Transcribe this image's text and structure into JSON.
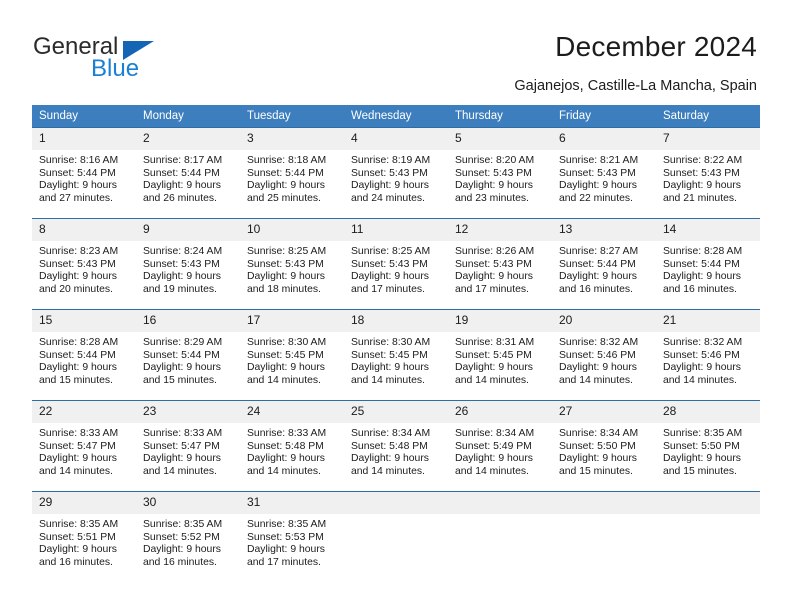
{
  "brand": {
    "name_top": "General",
    "name_bottom": "Blue",
    "triangle_color": "#1565b5",
    "blue_color": "#1b7fd4"
  },
  "header": {
    "title": "December 2024",
    "subtitle": "Gajanejos, Castille-La Mancha, Spain"
  },
  "theme": {
    "header_row_bg": "#3d7ebe",
    "cell_top_border": "#2e6da4",
    "daynum_bg": "#f0f0f0"
  },
  "calendar": {
    "weekday_headers": [
      "Sunday",
      "Monday",
      "Tuesday",
      "Wednesday",
      "Thursday",
      "Friday",
      "Saturday"
    ],
    "weeks": [
      [
        {
          "day": "1",
          "sunrise": "Sunrise: 8:16 AM",
          "sunset": "Sunset: 5:44 PM",
          "daylight1": "Daylight: 9 hours",
          "daylight2": "and 27 minutes."
        },
        {
          "day": "2",
          "sunrise": "Sunrise: 8:17 AM",
          "sunset": "Sunset: 5:44 PM",
          "daylight1": "Daylight: 9 hours",
          "daylight2": "and 26 minutes."
        },
        {
          "day": "3",
          "sunrise": "Sunrise: 8:18 AM",
          "sunset": "Sunset: 5:44 PM",
          "daylight1": "Daylight: 9 hours",
          "daylight2": "and 25 minutes."
        },
        {
          "day": "4",
          "sunrise": "Sunrise: 8:19 AM",
          "sunset": "Sunset: 5:43 PM",
          "daylight1": "Daylight: 9 hours",
          "daylight2": "and 24 minutes."
        },
        {
          "day": "5",
          "sunrise": "Sunrise: 8:20 AM",
          "sunset": "Sunset: 5:43 PM",
          "daylight1": "Daylight: 9 hours",
          "daylight2": "and 23 minutes."
        },
        {
          "day": "6",
          "sunrise": "Sunrise: 8:21 AM",
          "sunset": "Sunset: 5:43 PM",
          "daylight1": "Daylight: 9 hours",
          "daylight2": "and 22 minutes."
        },
        {
          "day": "7",
          "sunrise": "Sunrise: 8:22 AM",
          "sunset": "Sunset: 5:43 PM",
          "daylight1": "Daylight: 9 hours",
          "daylight2": "and 21 minutes."
        }
      ],
      [
        {
          "day": "8",
          "sunrise": "Sunrise: 8:23 AM",
          "sunset": "Sunset: 5:43 PM",
          "daylight1": "Daylight: 9 hours",
          "daylight2": "and 20 minutes."
        },
        {
          "day": "9",
          "sunrise": "Sunrise: 8:24 AM",
          "sunset": "Sunset: 5:43 PM",
          "daylight1": "Daylight: 9 hours",
          "daylight2": "and 19 minutes."
        },
        {
          "day": "10",
          "sunrise": "Sunrise: 8:25 AM",
          "sunset": "Sunset: 5:43 PM",
          "daylight1": "Daylight: 9 hours",
          "daylight2": "and 18 minutes."
        },
        {
          "day": "11",
          "sunrise": "Sunrise: 8:25 AM",
          "sunset": "Sunset: 5:43 PM",
          "daylight1": "Daylight: 9 hours",
          "daylight2": "and 17 minutes."
        },
        {
          "day": "12",
          "sunrise": "Sunrise: 8:26 AM",
          "sunset": "Sunset: 5:43 PM",
          "daylight1": "Daylight: 9 hours",
          "daylight2": "and 17 minutes."
        },
        {
          "day": "13",
          "sunrise": "Sunrise: 8:27 AM",
          "sunset": "Sunset: 5:44 PM",
          "daylight1": "Daylight: 9 hours",
          "daylight2": "and 16 minutes."
        },
        {
          "day": "14",
          "sunrise": "Sunrise: 8:28 AM",
          "sunset": "Sunset: 5:44 PM",
          "daylight1": "Daylight: 9 hours",
          "daylight2": "and 16 minutes."
        }
      ],
      [
        {
          "day": "15",
          "sunrise": "Sunrise: 8:28 AM",
          "sunset": "Sunset: 5:44 PM",
          "daylight1": "Daylight: 9 hours",
          "daylight2": "and 15 minutes."
        },
        {
          "day": "16",
          "sunrise": "Sunrise: 8:29 AM",
          "sunset": "Sunset: 5:44 PM",
          "daylight1": "Daylight: 9 hours",
          "daylight2": "and 15 minutes."
        },
        {
          "day": "17",
          "sunrise": "Sunrise: 8:30 AM",
          "sunset": "Sunset: 5:45 PM",
          "daylight1": "Daylight: 9 hours",
          "daylight2": "and 14 minutes."
        },
        {
          "day": "18",
          "sunrise": "Sunrise: 8:30 AM",
          "sunset": "Sunset: 5:45 PM",
          "daylight1": "Daylight: 9 hours",
          "daylight2": "and 14 minutes."
        },
        {
          "day": "19",
          "sunrise": "Sunrise: 8:31 AM",
          "sunset": "Sunset: 5:45 PM",
          "daylight1": "Daylight: 9 hours",
          "daylight2": "and 14 minutes."
        },
        {
          "day": "20",
          "sunrise": "Sunrise: 8:32 AM",
          "sunset": "Sunset: 5:46 PM",
          "daylight1": "Daylight: 9 hours",
          "daylight2": "and 14 minutes."
        },
        {
          "day": "21",
          "sunrise": "Sunrise: 8:32 AM",
          "sunset": "Sunset: 5:46 PM",
          "daylight1": "Daylight: 9 hours",
          "daylight2": "and 14 minutes."
        }
      ],
      [
        {
          "day": "22",
          "sunrise": "Sunrise: 8:33 AM",
          "sunset": "Sunset: 5:47 PM",
          "daylight1": "Daylight: 9 hours",
          "daylight2": "and 14 minutes."
        },
        {
          "day": "23",
          "sunrise": "Sunrise: 8:33 AM",
          "sunset": "Sunset: 5:47 PM",
          "daylight1": "Daylight: 9 hours",
          "daylight2": "and 14 minutes."
        },
        {
          "day": "24",
          "sunrise": "Sunrise: 8:33 AM",
          "sunset": "Sunset: 5:48 PM",
          "daylight1": "Daylight: 9 hours",
          "daylight2": "and 14 minutes."
        },
        {
          "day": "25",
          "sunrise": "Sunrise: 8:34 AM",
          "sunset": "Sunset: 5:48 PM",
          "daylight1": "Daylight: 9 hours",
          "daylight2": "and 14 minutes."
        },
        {
          "day": "26",
          "sunrise": "Sunrise: 8:34 AM",
          "sunset": "Sunset: 5:49 PM",
          "daylight1": "Daylight: 9 hours",
          "daylight2": "and 14 minutes."
        },
        {
          "day": "27",
          "sunrise": "Sunrise: 8:34 AM",
          "sunset": "Sunset: 5:50 PM",
          "daylight1": "Daylight: 9 hours",
          "daylight2": "and 15 minutes."
        },
        {
          "day": "28",
          "sunrise": "Sunrise: 8:35 AM",
          "sunset": "Sunset: 5:50 PM",
          "daylight1": "Daylight: 9 hours",
          "daylight2": "and 15 minutes."
        }
      ],
      [
        {
          "day": "29",
          "sunrise": "Sunrise: 8:35 AM",
          "sunset": "Sunset: 5:51 PM",
          "daylight1": "Daylight: 9 hours",
          "daylight2": "and 16 minutes."
        },
        {
          "day": "30",
          "sunrise": "Sunrise: 8:35 AM",
          "sunset": "Sunset: 5:52 PM",
          "daylight1": "Daylight: 9 hours",
          "daylight2": "and 16 minutes."
        },
        {
          "day": "31",
          "sunrise": "Sunrise: 8:35 AM",
          "sunset": "Sunset: 5:53 PM",
          "daylight1": "Daylight: 9 hours",
          "daylight2": "and 17 minutes."
        },
        {
          "day": "",
          "sunrise": "",
          "sunset": "",
          "daylight1": "",
          "daylight2": ""
        },
        {
          "day": "",
          "sunrise": "",
          "sunset": "",
          "daylight1": "",
          "daylight2": ""
        },
        {
          "day": "",
          "sunrise": "",
          "sunset": "",
          "daylight1": "",
          "daylight2": ""
        },
        {
          "day": "",
          "sunrise": "",
          "sunset": "",
          "daylight1": "",
          "daylight2": ""
        }
      ]
    ]
  }
}
